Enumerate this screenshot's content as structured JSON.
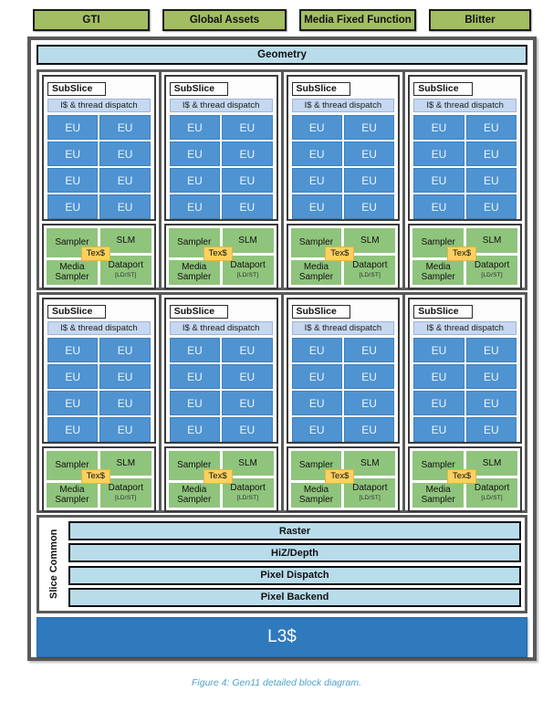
{
  "figure": {
    "caption": "Figure 4: Gen11 detailed block diagram."
  },
  "colors": {
    "green_bar": "#a3bd63",
    "light_blue_bar": "#b9dceb",
    "eu_blue": "#4f93d1",
    "l3_blue": "#2f79bd",
    "sampler_green": "#8fc47c",
    "texcache_yellow": "#fbd160",
    "dispatch_blue": "#c5d8ef",
    "frame_gray": "#5a5a5a",
    "caption_blue": "#4fa3c7"
  },
  "top_blocks": [
    {
      "label": "GTI"
    },
    {
      "label": "Global Assets"
    },
    {
      "label": "Media Fixed Function"
    },
    {
      "label": "Blitter"
    }
  ],
  "geometry": {
    "label": "Geometry"
  },
  "subslice": {
    "title": "SubSlice",
    "thread_dispatch": "I$ & thread dispatch",
    "eu_label": "EU",
    "eu_count": 8,
    "sampler": "Sampler",
    "texcache": "Tex$",
    "media_sampler_line1": "Media",
    "media_sampler_line2": "Sampler",
    "slm": "SLM",
    "dataport": "Dataport",
    "dataport_sub": "[LD/ST]"
  },
  "slice_rows": [
    {
      "name": "subslice-row-1",
      "columns": 4
    },
    {
      "name": "subslice-row-2",
      "columns": 4
    }
  ],
  "slice_common": {
    "label": "Slice Common",
    "bars": [
      {
        "label": "Raster"
      },
      {
        "label": "HiZ/Depth"
      },
      {
        "label": "Pixel Dispatch"
      },
      {
        "label": "Pixel Backend"
      }
    ]
  },
  "l3_cache": {
    "label": "L3$"
  }
}
